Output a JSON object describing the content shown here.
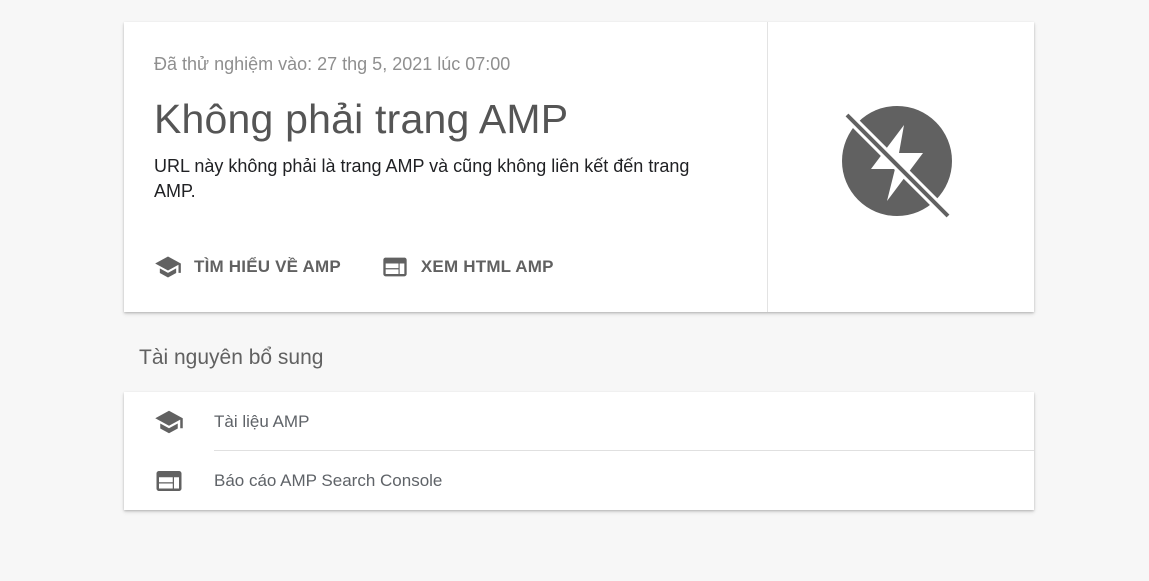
{
  "result": {
    "tested_on": "Đã thử nghiệm vào: 27 thg 5, 2021 lúc 07:00",
    "title": "Không phải trang AMP",
    "description": "URL này không phải là trang AMP và cũng không liên kết đến trang AMP.",
    "actions": [
      {
        "label": "TÌM HIỂU VỀ AMP",
        "icon": "school-icon"
      },
      {
        "label": "XEM HTML AMP",
        "icon": "web-view-icon"
      }
    ],
    "status_icon": "amp-off-icon"
  },
  "resources": {
    "title": "Tài nguyên bổ sung",
    "items": [
      {
        "label": "Tài liệu AMP",
        "icon": "school-icon"
      },
      {
        "label": "Báo cáo AMP Search Console",
        "icon": "web-view-icon"
      }
    ]
  },
  "colors": {
    "background": "#f7f7f7",
    "card": "#ffffff",
    "icon_gray": "#616161",
    "text_dark": "#202124",
    "text_muted": "#8f8f8f"
  }
}
